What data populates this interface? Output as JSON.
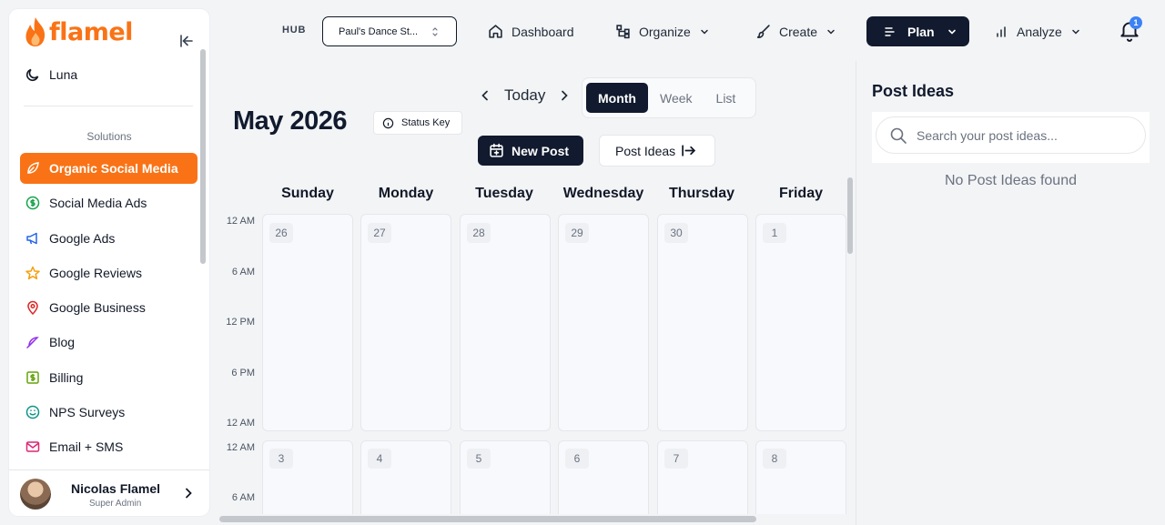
{
  "brand": {
    "name": "flamel",
    "accent": "#f97316"
  },
  "sidebar": {
    "luna_label": "Luna",
    "section_label": "Solutions",
    "items": [
      {
        "label": "Organic Social Media",
        "icon": "leaf-icon",
        "active": true
      },
      {
        "label": "Social Media Ads",
        "icon": "dollar-circle-icon"
      },
      {
        "label": "Google Ads",
        "icon": "megaphone-icon"
      },
      {
        "label": "Google Reviews",
        "icon": "star-icon"
      },
      {
        "label": "Google Business",
        "icon": "map-pin-icon"
      },
      {
        "label": "Blog",
        "icon": "feather-icon"
      },
      {
        "label": "Billing",
        "icon": "dollar-square-icon"
      },
      {
        "label": "NPS Surveys",
        "icon": "smile-icon"
      },
      {
        "label": "Email + SMS",
        "icon": "mail-icon"
      }
    ],
    "user": {
      "name": "Nicolas Flamel",
      "role": "Super Admin"
    }
  },
  "topnav": {
    "hub_label": "HUB",
    "hub_value": "Paul's Dance St...",
    "dashboard": "Dashboard",
    "organize": "Organize",
    "create": "Create",
    "plan": "Plan",
    "analyze": "Analyze",
    "notification_count": "1"
  },
  "calendar": {
    "month_title": "May 2026",
    "status_key": "Status Key",
    "today": "Today",
    "views": [
      "Month",
      "Week",
      "List"
    ],
    "active_view": "Month",
    "new_post": "New Post",
    "post_ideas": "Post Ideas",
    "days": [
      "Sunday",
      "Monday",
      "Tuesday",
      "Wednesday",
      "Thursday",
      "Friday"
    ],
    "time_labels_week1": [
      "12 AM",
      "6 AM",
      "12 PM",
      "6 PM",
      "12 AM"
    ],
    "time_labels_week2": [
      "12 AM",
      "6 AM"
    ],
    "week1_dates": [
      "26",
      "27",
      "28",
      "29",
      "30",
      "1"
    ],
    "week2_dates": [
      "3",
      "4",
      "5",
      "6",
      "7",
      "8"
    ]
  },
  "post_ideas_panel": {
    "title": "Post Ideas",
    "search_placeholder": "Search your post ideas...",
    "empty_message": "No Post Ideas found"
  }
}
